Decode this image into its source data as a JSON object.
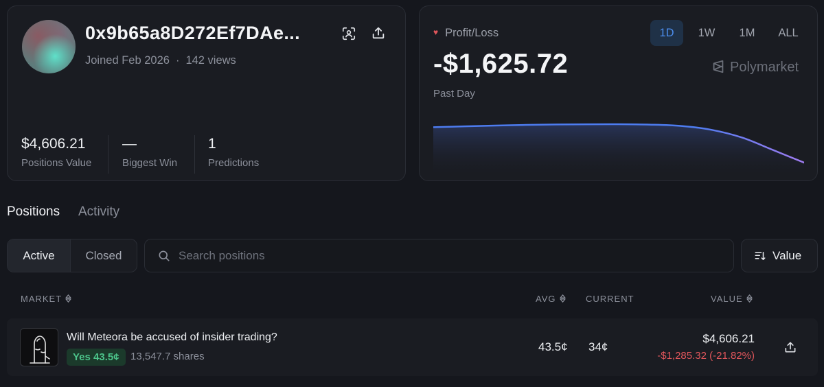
{
  "profile": {
    "username": "0x9b65a8D272Ef7DAe...",
    "joined": "Joined Feb 2026",
    "views": "142 views",
    "stats": [
      {
        "value": "$4,606.21",
        "label": "Positions Value"
      },
      {
        "value": "—",
        "label": "Biggest Win"
      },
      {
        "value": "1",
        "label": "Predictions"
      }
    ]
  },
  "pnl": {
    "label": "Profit/Loss",
    "value": "-$1,625.72",
    "period": "Past Day",
    "brand": "Polymarket",
    "ranges": [
      "1D",
      "1W",
      "1M",
      "ALL"
    ],
    "active_range": "1D",
    "colors": {
      "line_start": "#4d7cf0",
      "line_end": "#a07cf0",
      "loss": "#e0565b"
    }
  },
  "chart_data": {
    "type": "line",
    "title": "",
    "xlabel": "",
    "ylabel": "",
    "grid": false,
    "x": [
      0,
      1,
      2,
      3,
      4,
      5,
      6,
      7,
      8,
      9,
      10,
      11,
      12
    ],
    "series": [
      {
        "values": [
          0,
          40,
          75,
          105,
          125,
          135,
          138,
          120,
          60,
          -120,
          -480,
          -1050,
          -1625.72
        ]
      }
    ]
  },
  "tabs": {
    "positions": "Positions",
    "activity": "Activity"
  },
  "filters": {
    "active": "Active",
    "closed": "Closed"
  },
  "search": {
    "placeholder": "Search positions"
  },
  "sort": {
    "label": "Value"
  },
  "table": {
    "headers": {
      "market": "MARKET",
      "avg": "AVG",
      "current": "CURRENT",
      "value": "VALUE"
    },
    "rows": [
      {
        "title": "Will Meteora be accused of insider trading?",
        "outcome": "Yes 43.5¢",
        "shares": "13,547.7 shares",
        "avg": "43.5¢",
        "current": "34¢",
        "value": "$4,606.21",
        "pnl": "-$1,285.32 (-21.82%)"
      }
    ]
  }
}
